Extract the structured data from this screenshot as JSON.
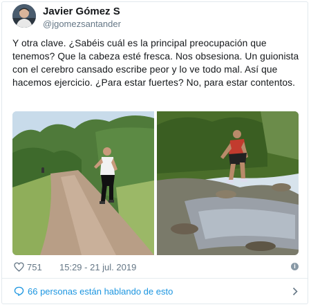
{
  "author": {
    "name": "Javier Gómez S",
    "handle": "@jgomezsantander",
    "avatar_icon": "avatar-photo"
  },
  "tweet": {
    "text": "Y otra clave. ¿Sabéis cuál es la principal preocupación que tenemos? Que la cabeza esté fresca. Nos obsesiona. Un guionista con el cerebro cansado escribe peor y lo ve todo mal. Así que hacemos ejercicio. ¿Para estar fuertes? No, para estar contentos."
  },
  "media": {
    "photos": [
      {
        "description_icon": "photo-runner-dirt-road"
      },
      {
        "description_icon": "photo-runner-crossing-stream"
      }
    ]
  },
  "meta": {
    "likes": "751",
    "timestamp": "15:29 - 21 jul. 2019",
    "info_icon": "info-icon"
  },
  "conversation": {
    "label": "66 personas están hablando de esto"
  },
  "colors": {
    "link": "#1b95e0",
    "secondary": "#657786",
    "border": "#e1e8ed"
  }
}
